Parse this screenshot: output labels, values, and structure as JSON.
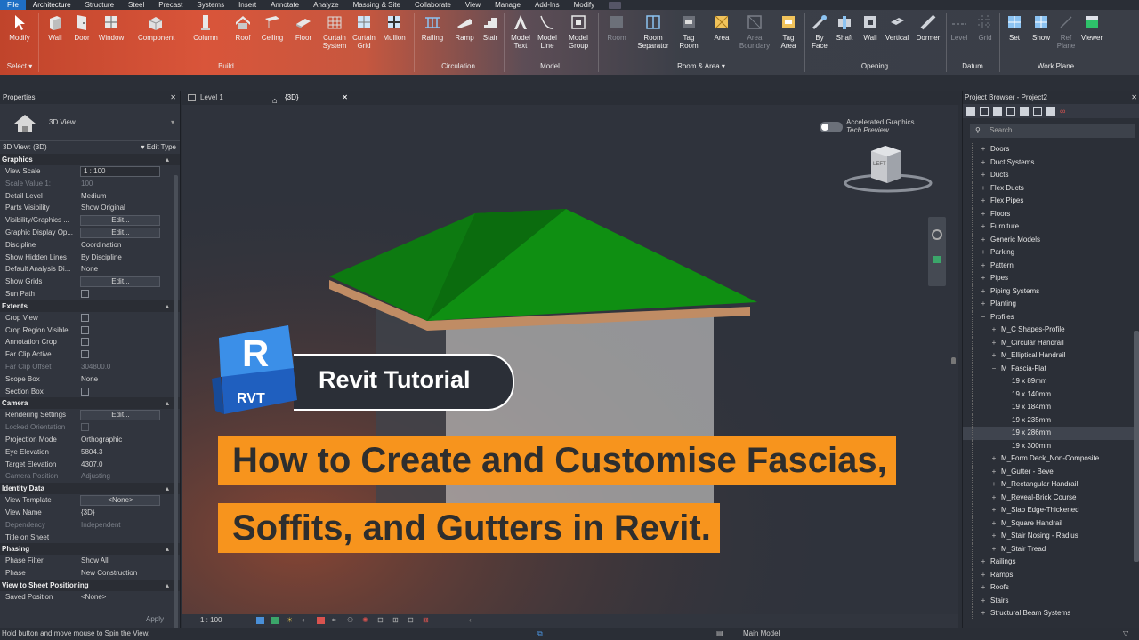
{
  "menu": {
    "file": "File",
    "items": [
      "Architecture",
      "Structure",
      "Steel",
      "Precast",
      "Systems",
      "Insert",
      "Annotate",
      "Analyze",
      "Massing & Site",
      "Collaborate",
      "View",
      "Manage",
      "Add-Ins",
      "Modify"
    ]
  },
  "ribbon": {
    "buttons": {
      "modify": "Modify",
      "wall": "Wall",
      "door": "Door",
      "window": "Window",
      "component": "Component",
      "column": "Column",
      "roof": "Roof",
      "ceiling": "Ceiling",
      "floor": "Floor",
      "curtain_system": "Curtain\nSystem",
      "curtain_grid": "Curtain\nGrid",
      "mullion": "Mullion",
      "railing": "Railing",
      "ramp": "Ramp",
      "stair": "Stair",
      "model_text": "Model\nText",
      "model_line": "Model\nLine",
      "model_group": "Model\nGroup",
      "room": "Room",
      "room_separator": "Room\nSeparator",
      "tag_room": "Tag\nRoom",
      "area": "Area",
      "area_boundary": "Area\nBoundary",
      "tag_area": "Tag\nArea",
      "by_face": "By\nFace",
      "shaft": "Shaft",
      "op_wall": "Wall",
      "vertical": "Vertical",
      "dormer": "Dormer",
      "level": "Level",
      "grid": "Grid",
      "set": "Set",
      "show": "Show",
      "ref_plane": "Ref\nPlane",
      "viewer": "Viewer"
    },
    "groups": {
      "select": "Select",
      "build": "Build",
      "circulation": "Circulation",
      "model": "Model",
      "room_area": "Room & Area",
      "opening": "Opening",
      "datum": "Datum",
      "work_plane": "Work Plane"
    }
  },
  "properties": {
    "title": "Properties",
    "type_name": "3D View",
    "view_selector": "3D View: (3D)",
    "edit_type": "Edit Type",
    "sections": [
      {
        "name": "Graphics",
        "rows": [
          {
            "k": "View Scale",
            "v": "1 : 100",
            "kind": "field"
          },
          {
            "k": "Scale Value    1:",
            "v": "100",
            "kind": "dim"
          },
          {
            "k": "Detail Level",
            "v": "Medium"
          },
          {
            "k": "Parts Visibility",
            "v": "Show Original"
          },
          {
            "k": "Visibility/Graphics ...",
            "v": "Edit...",
            "kind": "btn"
          },
          {
            "k": "Graphic Display Op...",
            "v": "Edit...",
            "kind": "btn"
          },
          {
            "k": "Discipline",
            "v": "Coordination"
          },
          {
            "k": "Show Hidden Lines",
            "v": "By Discipline"
          },
          {
            "k": "Default Analysis Di...",
            "v": "None"
          },
          {
            "k": "Show Grids",
            "v": "Edit...",
            "kind": "btn"
          },
          {
            "k": "Sun Path",
            "v": "",
            "kind": "chk"
          }
        ]
      },
      {
        "name": "Extents",
        "rows": [
          {
            "k": "Crop View",
            "v": "",
            "kind": "chk"
          },
          {
            "k": "Crop Region Visible",
            "v": "",
            "kind": "chk"
          },
          {
            "k": "Annotation Crop",
            "v": "",
            "kind": "chk"
          },
          {
            "k": "Far Clip Active",
            "v": "",
            "kind": "chk"
          },
          {
            "k": "Far Clip Offset",
            "v": "304800.0",
            "kind": "dim"
          },
          {
            "k": "Scope Box",
            "v": "None"
          },
          {
            "k": "Section Box",
            "v": "",
            "kind": "chk"
          }
        ]
      },
      {
        "name": "Camera",
        "rows": [
          {
            "k": "Rendering Settings",
            "v": "Edit...",
            "kind": "btn"
          },
          {
            "k": "Locked Orientation",
            "v": "",
            "kind": "chkdim"
          },
          {
            "k": "Projection Mode",
            "v": "Orthographic"
          },
          {
            "k": "Eye Elevation",
            "v": "5804.3"
          },
          {
            "k": "Target Elevation",
            "v": "4307.0"
          },
          {
            "k": "Camera Position",
            "v": "Adjusting",
            "kind": "dim"
          }
        ]
      },
      {
        "name": "Identity Data",
        "rows": [
          {
            "k": "View Template",
            "v": "<None>",
            "kind": "btn"
          },
          {
            "k": "View Name",
            "v": "{3D}"
          },
          {
            "k": "Dependency",
            "v": "Independent",
            "kind": "dim"
          },
          {
            "k": "Title on Sheet",
            "v": ""
          }
        ]
      },
      {
        "name": "Phasing",
        "rows": [
          {
            "k": "Phase Filter",
            "v": "Show All"
          },
          {
            "k": "Phase",
            "v": "New Construction"
          }
        ]
      },
      {
        "name": "View to Sheet Positioning",
        "rows": [
          {
            "k": "Saved Position",
            "v": "<None>"
          }
        ]
      }
    ],
    "apply": "Apply"
  },
  "tabs": [
    {
      "label": "Level 1"
    },
    {
      "label": "{3D}"
    }
  ],
  "viewport": {
    "accel_title": "Accelerated Graphics",
    "accel_sub": "Tech Preview",
    "viewcube_face": "LEFT",
    "scale": "1 : 100",
    "roof_color": "#0f8f12",
    "fascia_color": "#c08c64",
    "wall_color": "#b5b5b5"
  },
  "browser": {
    "title": "Project Browser - Project2",
    "search_placeholder": "Search",
    "nodes": [
      {
        "label": "Doors",
        "pm": "+",
        "level": 0
      },
      {
        "label": "Duct Systems",
        "pm": "+",
        "level": 0
      },
      {
        "label": "Ducts",
        "pm": "+",
        "level": 0
      },
      {
        "label": "Flex Ducts",
        "pm": "+",
        "level": 0
      },
      {
        "label": "Flex Pipes",
        "pm": "+",
        "level": 0
      },
      {
        "label": "Floors",
        "pm": "+",
        "level": 0
      },
      {
        "label": "Furniture",
        "pm": "+",
        "level": 0
      },
      {
        "label": "Generic Models",
        "pm": "+",
        "level": 0
      },
      {
        "label": "Parking",
        "pm": "+",
        "level": 0
      },
      {
        "label": "Pattern",
        "pm": "+",
        "level": 0
      },
      {
        "label": "Pipes",
        "pm": "+",
        "level": 0
      },
      {
        "label": "Piping Systems",
        "pm": "+",
        "level": 0
      },
      {
        "label": "Planting",
        "pm": "+",
        "level": 0
      },
      {
        "label": "Profiles",
        "pm": "−",
        "level": 0
      },
      {
        "label": "M_C Shapes-Profile",
        "pm": "+",
        "level": 1
      },
      {
        "label": "M_Circular Handrail",
        "pm": "+",
        "level": 1
      },
      {
        "label": "M_Elliptical Handrail",
        "pm": "+",
        "level": 1
      },
      {
        "label": "M_Fascia-Flat",
        "pm": "−",
        "level": 1
      },
      {
        "label": "19 x 89mm",
        "pm": "",
        "level": 2
      },
      {
        "label": "19 x 140mm",
        "pm": "",
        "level": 2
      },
      {
        "label": "19 x 184mm",
        "pm": "",
        "level": 2
      },
      {
        "label": "19 x 235mm",
        "pm": "",
        "level": 2
      },
      {
        "label": "19 x 286mm",
        "pm": "",
        "level": 2,
        "sel": true
      },
      {
        "label": "19 x 300mm",
        "pm": "",
        "level": 2
      },
      {
        "label": "M_Form Deck_Non-Composite",
        "pm": "+",
        "level": 1
      },
      {
        "label": "M_Gutter - Bevel",
        "pm": "+",
        "level": 1
      },
      {
        "label": "M_Rectangular Handrail",
        "pm": "+",
        "level": 1
      },
      {
        "label": "M_Reveal-Brick Course",
        "pm": "+",
        "level": 1
      },
      {
        "label": "M_Slab Edge-Thickened",
        "pm": "+",
        "level": 1
      },
      {
        "label": "M_Square Handrail",
        "pm": "+",
        "level": 1
      },
      {
        "label": "M_Stair Nosing - Radius",
        "pm": "+",
        "level": 1
      },
      {
        "label": "M_Stair Tread",
        "pm": "+",
        "level": 1
      },
      {
        "label": "Railings",
        "pm": "+",
        "level": 0
      },
      {
        "label": "Ramps",
        "pm": "+",
        "level": 0
      },
      {
        "label": "Roofs",
        "pm": "+",
        "level": 0
      },
      {
        "label": "Stairs",
        "pm": "+",
        "level": 0
      },
      {
        "label": "Structural Beam Systems",
        "pm": "+",
        "level": 0
      }
    ]
  },
  "statusbar": {
    "hint": "Hold button and move mouse to Spin the View.",
    "model": "Main Model"
  },
  "overlay": {
    "logo_letter": "R",
    "logo_sub": "RVT",
    "tutorial_label": "Revit Tutorial",
    "title_line1": "How to Create and Customise Fascias,",
    "title_line2": "Soffits, and Gutters in Revit.",
    "accent": "#f7941d"
  }
}
